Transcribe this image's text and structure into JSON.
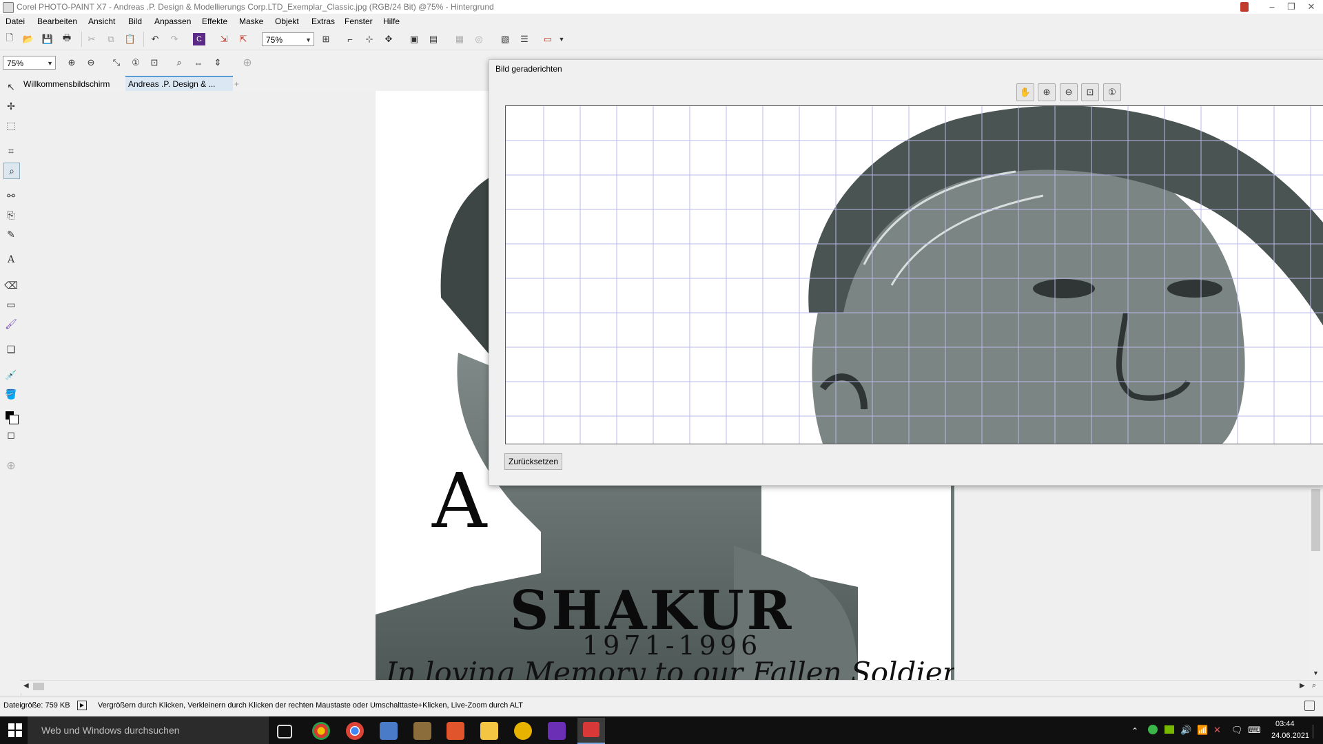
{
  "window": {
    "title": "Corel PHOTO-PAINT X7 - Andreas .P. Design & Modellierungs Corp.LTD_Exemplar_Classic.jpg (RGB/24 Bit) @75% - Hintergrund",
    "minimize": "–",
    "maximize": "❐",
    "close": "✕"
  },
  "menu": [
    "Datei",
    "Bearbeiten",
    "Ansicht",
    "Bild",
    "Anpassen",
    "Effekte",
    "Maske",
    "Objekt",
    "Extras",
    "Fenster",
    "Hilfe"
  ],
  "toolbar": {
    "zoom_value": "75%"
  },
  "toolbar2": {
    "zoom_value": "75%"
  },
  "tabs": {
    "welcome": "Willkommensbildschirm",
    "document": "Andreas .P. Design & ...",
    "add": "+"
  },
  "document": {
    "big_letter": "A",
    "name_line": "SHAKUR",
    "memory_line": "In loving Memory to our Fallen Soldier",
    "years": "1971-1996"
  },
  "dialog": {
    "title": "Bild geraderichten",
    "reset_label": "Zurücksetzen"
  },
  "statusbar": {
    "filesize": "Dateigröße: 759 KB",
    "hint": "Vergrößern durch Klicken, Verkleinern durch Klicken der rechten Maustaste oder Umschalttaste+Klicken, Live-Zoom durch ALT"
  },
  "taskbar": {
    "search_placeholder": "Web und Windows durchsuchen",
    "time": "03:44",
    "date": "24.06.2021"
  },
  "colors": {
    "taskbar": "#101010",
    "grid": "#b8b8e8",
    "photo_tone": "#5f6a68"
  }
}
